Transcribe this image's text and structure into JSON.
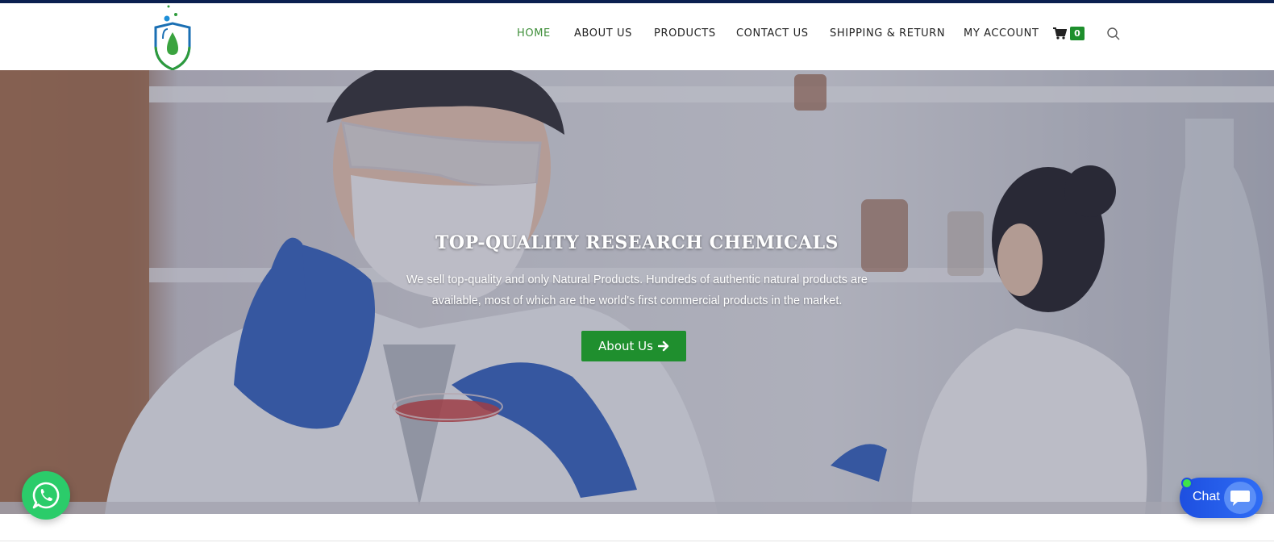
{
  "nav": {
    "items": [
      {
        "label": "HOME",
        "active": true
      },
      {
        "label": "ABOUT US",
        "active": false
      },
      {
        "label": "PRODUCTS",
        "active": false
      },
      {
        "label": "CONTACT US",
        "active": false
      },
      {
        "label": "SHIPPING & RETURN",
        "active": false
      },
      {
        "label": "MY ACCOUNT",
        "active": false
      }
    ],
    "cart_count": "0",
    "cart_icon": "shopping-cart-icon",
    "search_icon": "search-icon"
  },
  "hero": {
    "title": "TOP-QUALITY RESEARCH CHEMICALS",
    "text": "We sell top-quality and only Natural Products. Hundreds of authentic natural products are available, most of which are the world's first commercial products in the market.",
    "button_label": "About Us",
    "button_icon": "arrow-right-icon"
  },
  "widgets": {
    "whatsapp_icon": "whatsapp-icon",
    "chat_label": "Chat",
    "chat_icon": "chat-bubble-icon"
  },
  "colors": {
    "brand_green": "#1f8f2e",
    "nav_active": "#3f8f3a",
    "top_border": "#0b2050",
    "chat_blue": "#1d4fe0",
    "whatsapp_green": "#2bcc6a"
  }
}
